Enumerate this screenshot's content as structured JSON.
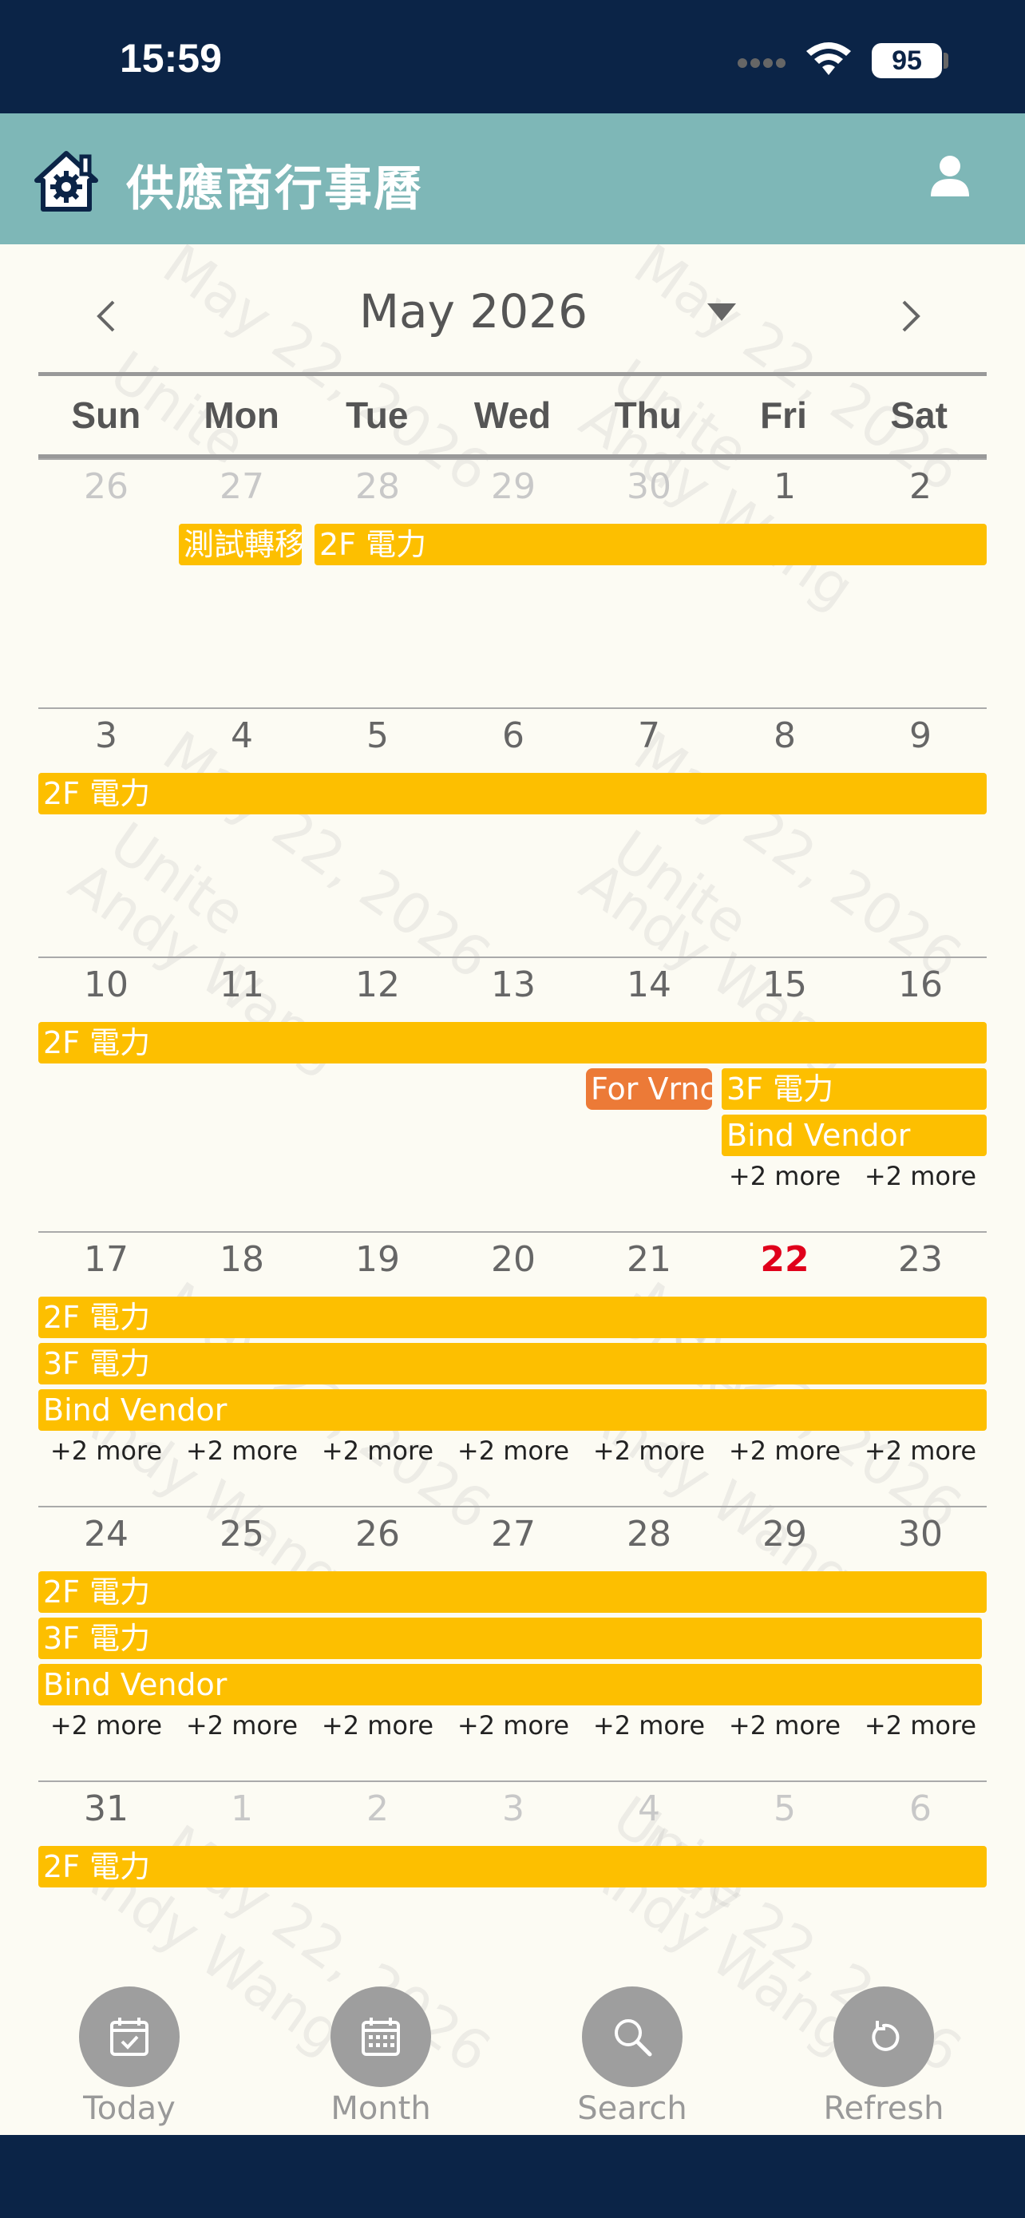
{
  "status": {
    "time": "15:59",
    "battery": "95"
  },
  "app": {
    "title": "供應商行事曆"
  },
  "calendar": {
    "month_label": "May 2026",
    "weekdays": [
      "Sun",
      "Mon",
      "Tue",
      "Wed",
      "Thu",
      "Fri",
      "Sat"
    ],
    "weeks": [
      {
        "days": [
          "26",
          "27",
          "28",
          "29",
          "30",
          "1",
          "2"
        ],
        "events": [
          "測試轉移",
          "2F 電力"
        ],
        "more": []
      },
      {
        "days": [
          "3",
          "4",
          "5",
          "6",
          "7",
          "8",
          "9"
        ],
        "events": [
          "2F 電力"
        ],
        "more": []
      },
      {
        "days": [
          "10",
          "11",
          "12",
          "13",
          "14",
          "15",
          "16"
        ],
        "events": [
          "2F 電力",
          "For Vrnc",
          "3F 電力",
          "Bind Vendor"
        ],
        "more": [
          "+2 more",
          "+2 more"
        ]
      },
      {
        "days": [
          "17",
          "18",
          "19",
          "20",
          "21",
          "22",
          "23"
        ],
        "events": [
          "2F 電力",
          "3F 電力",
          "Bind Vendor"
        ],
        "more": [
          "+2 more",
          "+2 more",
          "+2 more",
          "+2 more",
          "+2 more",
          "+2 more",
          "+2 more"
        ]
      },
      {
        "days": [
          "24",
          "25",
          "26",
          "27",
          "28",
          "29",
          "30"
        ],
        "events": [
          "2F 電力",
          "3F 電力",
          "Bind Vendor"
        ],
        "more": [
          "+2 more",
          "+2 more",
          "+2 more",
          "+2 more",
          "+2 more",
          "+2 more",
          "+2 more"
        ]
      },
      {
        "days": [
          "31",
          "1",
          "2",
          "3",
          "4",
          "5",
          "6"
        ],
        "events": [
          "2F 電力"
        ],
        "more": []
      }
    ]
  },
  "watermark": {
    "date": "May 22, 2026",
    "org": "Unite",
    "user": "Andy Wang"
  },
  "tabs": [
    {
      "label": "Today",
      "icon": "calendar-check-icon"
    },
    {
      "label": "Month",
      "icon": "calendar-grid-icon"
    },
    {
      "label": "Search",
      "icon": "search-icon"
    },
    {
      "label": "Refresh",
      "icon": "refresh-icon"
    }
  ],
  "colors": {
    "header": "#7eb7b7",
    "status_bar": "#0b2447",
    "event": "#fdbf00",
    "event_alt": "#ec7a37",
    "today": "#e0001b"
  }
}
